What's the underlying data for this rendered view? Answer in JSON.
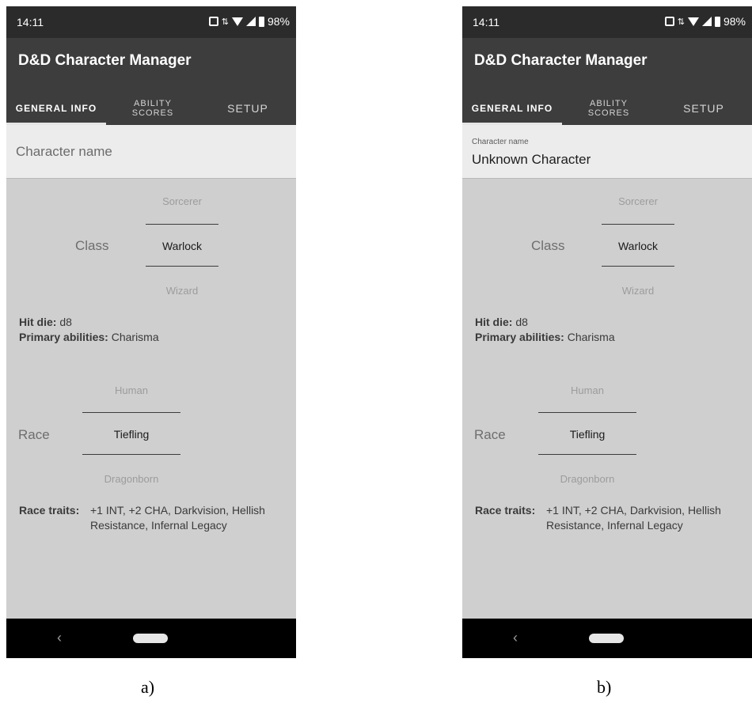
{
  "status": {
    "time": "14:11",
    "battery": "98%"
  },
  "app": {
    "title": "D&D Character Manager"
  },
  "tabs": [
    {
      "label": "GENERAL INFO"
    },
    {
      "label1": "ABILITY",
      "label2": "SCORES"
    },
    {
      "label": "SETUP"
    }
  ],
  "name_field": {
    "placeholder": "Character name",
    "label": "Character name",
    "value": "Unknown Character"
  },
  "class_picker": {
    "label": "Class",
    "options": [
      "Sorcerer",
      "Warlock",
      "Wizard"
    ],
    "selected": "Warlock"
  },
  "class_info": {
    "hit_die_key": "Hit die:",
    "hit_die": "d8",
    "primary_key": "Primary abilities:",
    "primary": "Charisma"
  },
  "race_picker": {
    "label": "Race",
    "options": [
      "Human",
      "Tiefling",
      "Dragonborn"
    ],
    "selected": "Tiefling"
  },
  "race_traits": {
    "key": "Race traits:",
    "value": "+1 INT, +2 CHA, Darkvision, Hellish Resistance, Infernal Legacy"
  },
  "captions": [
    "a)",
    "b)"
  ],
  "icons": [
    "vibrate-icon",
    "data-arrows-icon",
    "wifi-icon",
    "signal-icon",
    "battery-icon",
    "back-icon",
    "home-icon"
  ],
  "colors": {
    "app_bar": "#3d3d3d",
    "status_bar": "#2b2b2b",
    "background": "#cfcfcf",
    "nav_bar": "#000000"
  }
}
